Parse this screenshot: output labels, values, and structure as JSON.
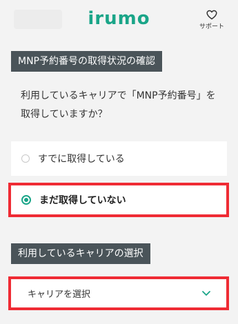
{
  "header": {
    "logo": "irumo",
    "support_label": "サポート"
  },
  "mnp_section": {
    "title": "MNP予約番号の取得状況の確認",
    "question": "利用しているキャリアで「MNP予約番号」を取得していますか？",
    "options": [
      {
        "label": "すでに取得している",
        "selected": false
      },
      {
        "label": "まだ取得していない",
        "selected": true
      }
    ]
  },
  "carrier_section": {
    "title": "利用しているキャリアの選択",
    "select_value": "キャリアを選択"
  },
  "colors": {
    "brand": "#1aa588",
    "label_bg": "#4a5459",
    "highlight": "#ef2b34"
  },
  "icons": {
    "support": "heart-icon",
    "select": "chevron-down-icon"
  }
}
